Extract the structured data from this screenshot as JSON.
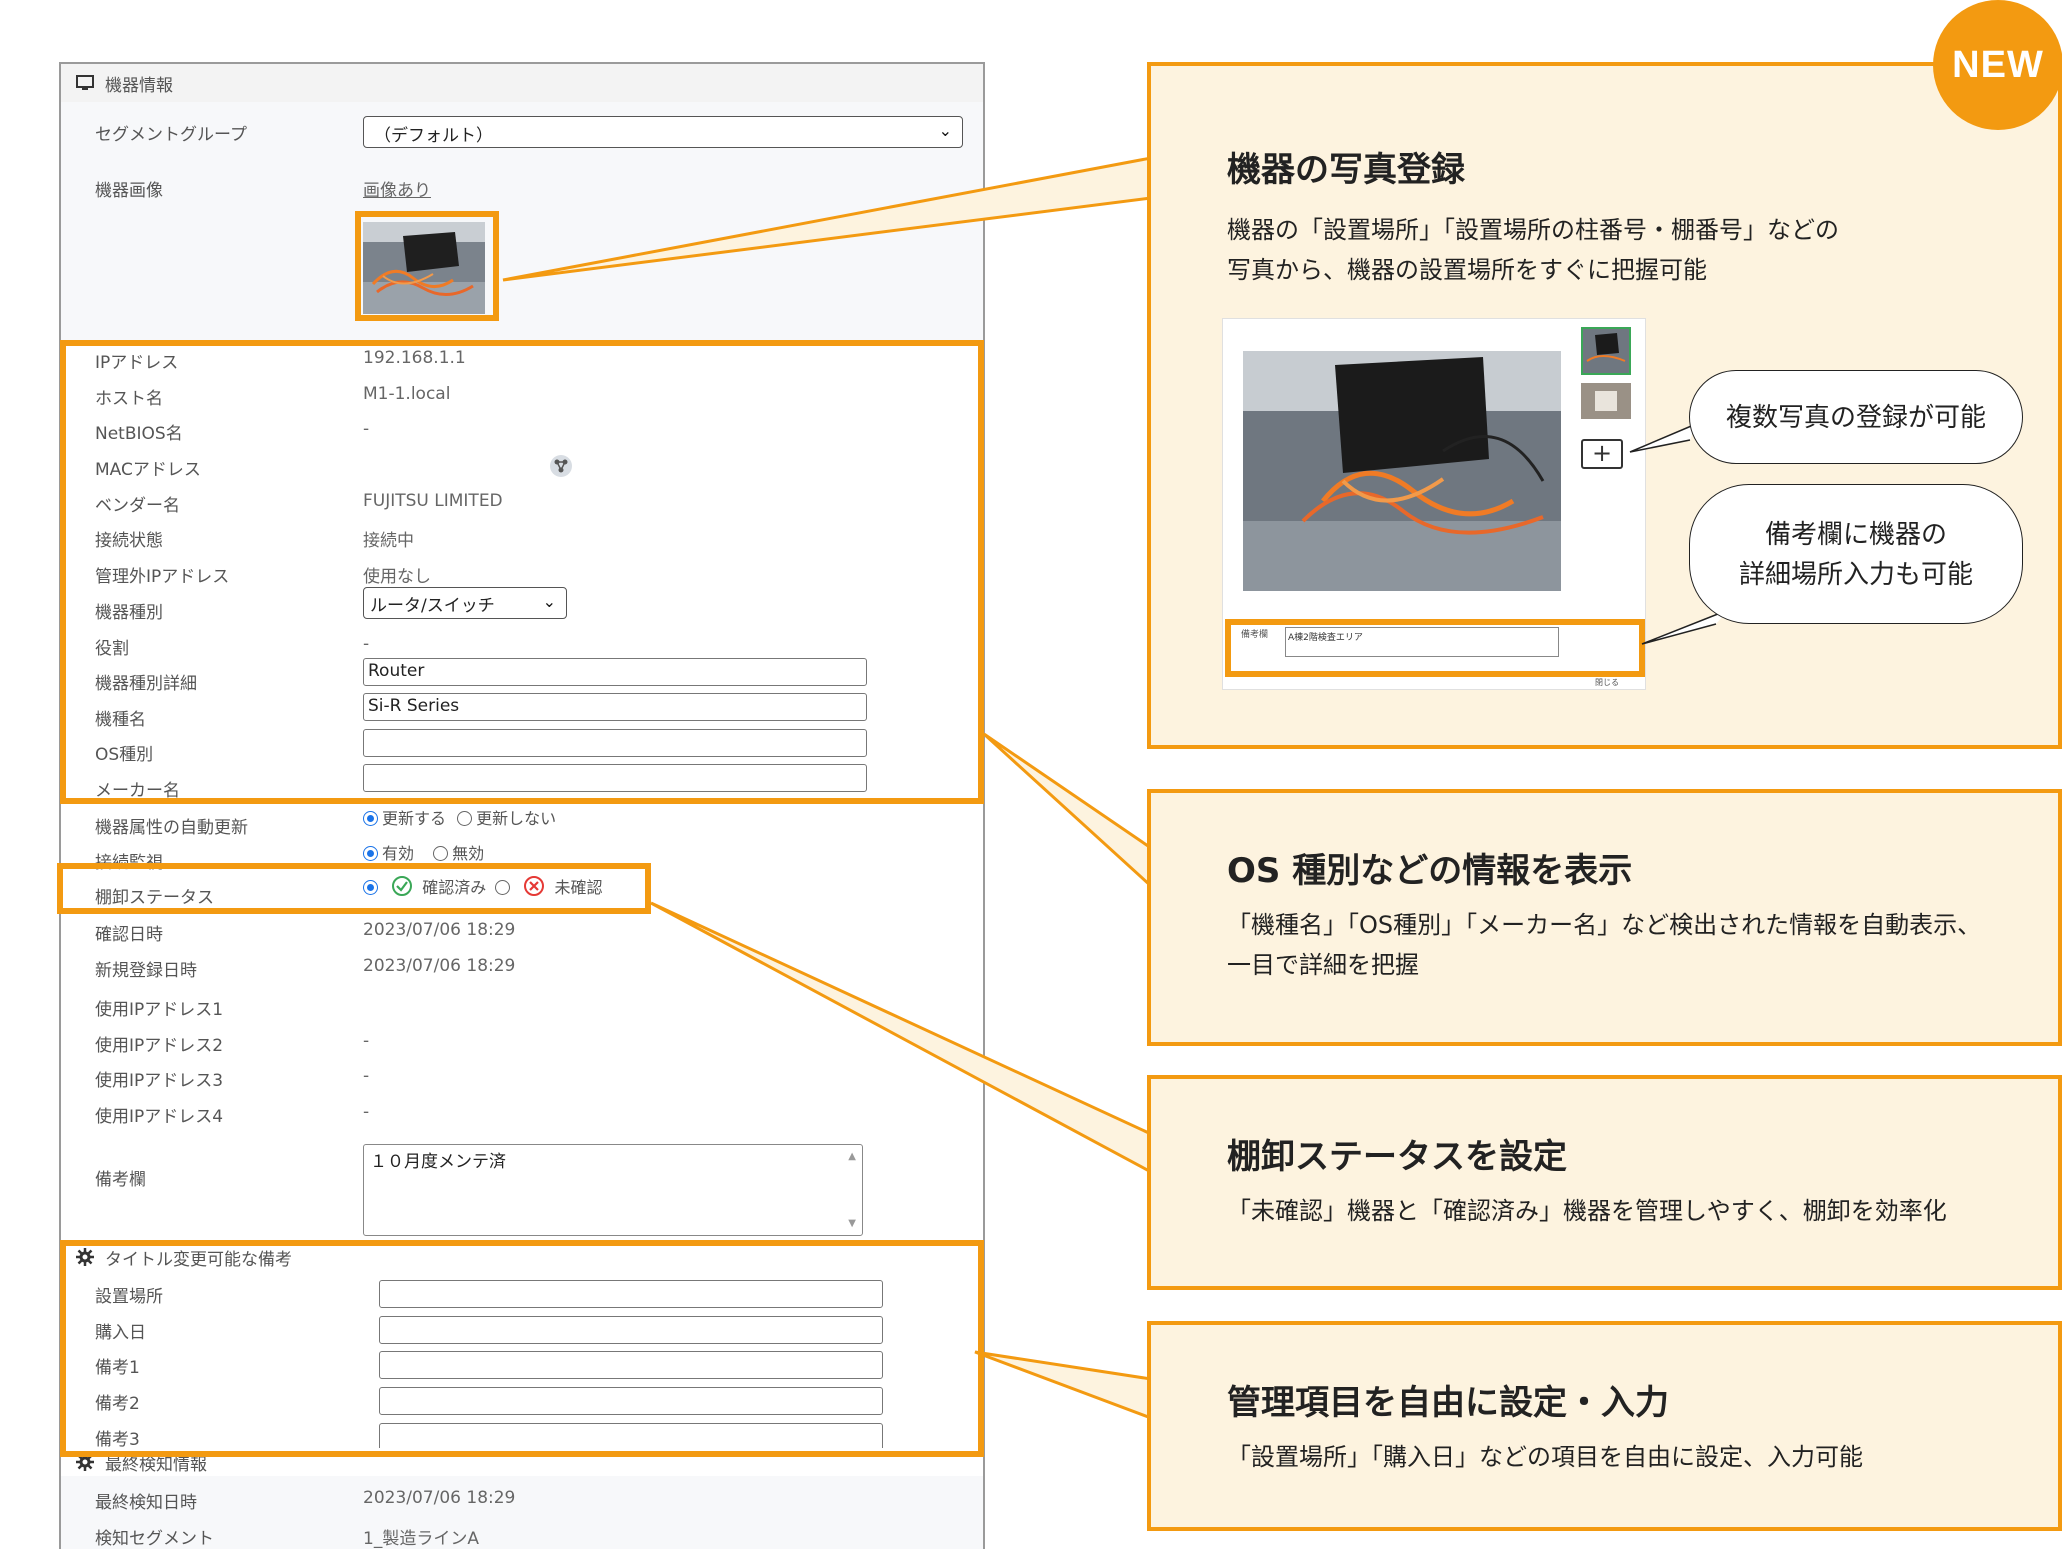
{
  "panel": {
    "device_section_title": "機器情報",
    "segment_group": {
      "label": "セグメントグループ",
      "value": "（デフォルト）"
    },
    "device_image": {
      "label": "機器画像",
      "link": "画像あり"
    },
    "fields": [
      {
        "key": "ip",
        "label": "IPアドレス",
        "value": "192.168.1.1"
      },
      {
        "key": "host",
        "label": "ホスト名",
        "value": "M1-1.local"
      },
      {
        "key": "netbios",
        "label": "NetBIOS名",
        "value": "-"
      },
      {
        "key": "mac",
        "label": "MACアドレス",
        "value": ""
      },
      {
        "key": "vendor",
        "label": "ベンダー名",
        "value": "FUJITSU LIMITED"
      },
      {
        "key": "conn",
        "label": "接続状態",
        "value": "接続中"
      },
      {
        "key": "unmanaged",
        "label": "管理外IPアドレス",
        "value": "使用なし"
      },
      {
        "key": "type",
        "label": "機器種別",
        "value": ""
      },
      {
        "key": "role",
        "label": "役割",
        "value": "-"
      },
      {
        "key": "type_detail",
        "label": "機器種別詳細",
        "value": ""
      },
      {
        "key": "model",
        "label": "機種名",
        "value": ""
      },
      {
        "key": "os",
        "label": "OS種別",
        "value": ""
      },
      {
        "key": "maker",
        "label": "メーカー名",
        "value": ""
      },
      {
        "key": "auto_update",
        "label": "機器属性の自動更新",
        "value": ""
      },
      {
        "key": "monitor",
        "label": "接続監視",
        "value": ""
      },
      {
        "key": "inventory",
        "label": "棚卸ステータス",
        "value": ""
      },
      {
        "key": "confirm_date",
        "label": "確認日時",
        "value": "2023/07/06 18:29"
      },
      {
        "key": "reg_date",
        "label": "新規登録日時",
        "value": "2023/07/06 18:29"
      },
      {
        "key": "ip1",
        "label": "使用IPアドレス1",
        "value": ""
      },
      {
        "key": "ip2",
        "label": "使用IPアドレス2",
        "value": "-"
      },
      {
        "key": "ip3",
        "label": "使用IPアドレス3",
        "value": "-"
      },
      {
        "key": "ip4",
        "label": "使用IPアドレス4",
        "value": "-"
      },
      {
        "key": "remarks",
        "label": "備考欄",
        "value": ""
      }
    ],
    "type_select": "ルータ/スイッチ",
    "type_detail_input": "Router",
    "model_input": "Si-R Series",
    "os_input": "",
    "maker_input": "",
    "auto_update_on": "更新する",
    "auto_update_off": "更新しない",
    "monitor_on": "有効",
    "monitor_off": "無効",
    "inventory_confirmed": "確認済み",
    "inventory_unconfirmed": "未確認",
    "remarks_text": "１０月度メンテ済",
    "custom_section_title": "タイトル変更可能な備考",
    "custom_fields": [
      {
        "label": "設置場所",
        "value": ""
      },
      {
        "label": "購入日",
        "value": ""
      },
      {
        "label": "備考1",
        "value": ""
      },
      {
        "label": "備考2",
        "value": ""
      },
      {
        "label": "備考3",
        "value": ""
      }
    ],
    "last_section_title": "最終検知情報",
    "last_fields": [
      {
        "label": "最終検知日時",
        "value": "2023/07/06 18:29"
      },
      {
        "label": "検知セグメント",
        "value": "1_製造ラインA"
      }
    ]
  },
  "cards": [
    {
      "title": "機器の写真登録",
      "lines": [
        "機器の「設置場所」「設置場所の柱番号・棚番号」などの",
        "写真から、機器の設置場所をすぐに把握可能"
      ]
    },
    {
      "title": "OS 種別などの情報を表示",
      "lines": [
        "「機種名」「OS種別」「メーカー名」など検出された情報を自動表示、",
        "一目で詳細を把握"
      ]
    },
    {
      "title": "棚卸ステータスを設定",
      "lines": [
        "「未確認」機器と「確認済み」機器を管理しやすく、棚卸を効率化"
      ]
    },
    {
      "title": "管理項目を自由に設定・入力",
      "lines": [
        "「設置場所」「購入日」などの項目を自由に設定、入力可能"
      ]
    }
  ],
  "badge": "NEW",
  "bubbles": {
    "multi_photo": "複数写真の登録が可能",
    "remarks_line1": "備考欄に機器の",
    "remarks_line2": "詳細場所入力も可能"
  },
  "mini": {
    "remarks_label": "備考欄",
    "remarks_text": "A棟2階検査エリア",
    "add_icon": "+",
    "close_label": "閉じる"
  },
  "colors": {
    "accent": "#f39a11",
    "card_bg": "#fdf3df",
    "link": "#1a56c9",
    "radio": "#1a73e8"
  }
}
